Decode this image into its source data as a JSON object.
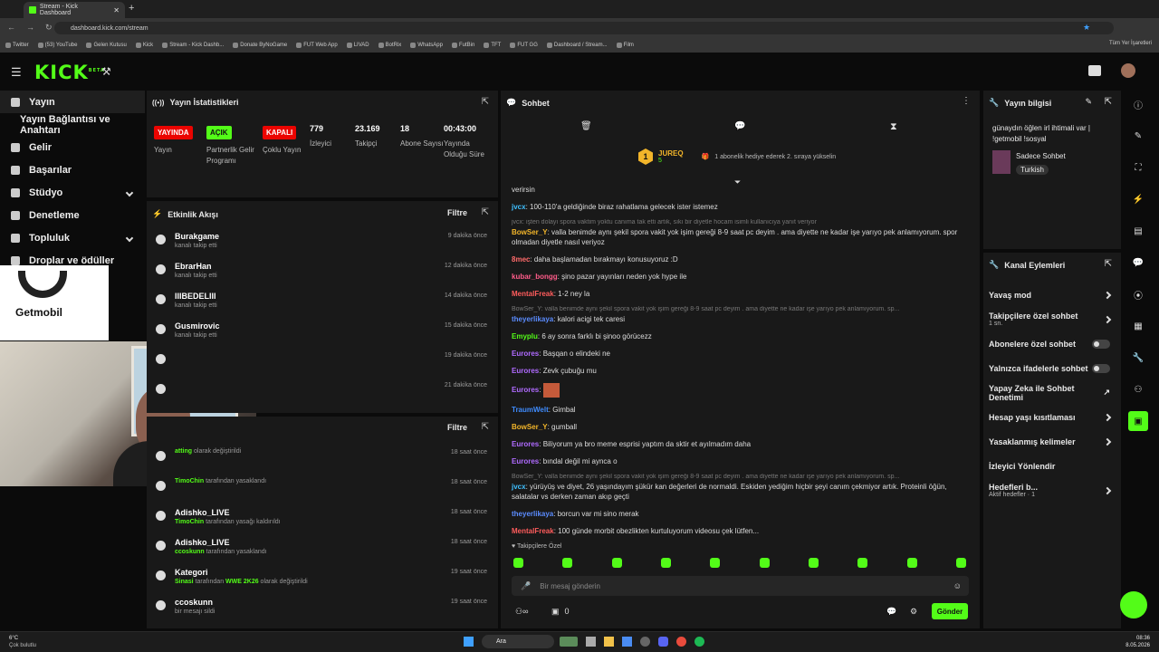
{
  "browser": {
    "tab_title": "Stream - Kick Dashboard",
    "url": "dashboard.kick.com/stream",
    "bookmarks": [
      "Twitter",
      "(53) YouTube",
      "Gelen Kutusu",
      "Kick",
      "Stream - Kick Dashb...",
      "Donate ByNoGame",
      "FUT Web App",
      "LIVAD",
      "BotRix",
      "WhatsApp",
      "FutBin",
      "TFT",
      "FUT GG",
      "Dashboard / Stream...",
      "Film"
    ],
    "all_bookmarks": "Tüm Yer İşaretleri"
  },
  "app": {
    "logo": "KICK",
    "logo_sup": "BETA"
  },
  "sidebar": {
    "items": [
      {
        "label": "Yayın"
      },
      {
        "label": "Yayın Bağlantısı ve Anahtarı"
      },
      {
        "label": "Gelir"
      },
      {
        "label": "Başarılar"
      },
      {
        "label": "Stüdyo"
      },
      {
        "label": "Denetleme"
      },
      {
        "label": "Topluluk"
      },
      {
        "label": "Droplar ve ödüller"
      }
    ]
  },
  "overlay": {
    "brand": "Getmobil"
  },
  "stats": {
    "title": "Yayın İstatistikleri",
    "badges": [
      {
        "text": "YAYINDA",
        "label": "Yayın",
        "color": "#eb0400"
      },
      {
        "text": "AÇIK",
        "label": "Partnerlik Gelir Programı",
        "color": "#53fc18"
      },
      {
        "text": "KAPALI",
        "label": "Çoklu Yayın",
        "color": "#eb0400"
      }
    ],
    "values": [
      {
        "value": "779",
        "label": "İzleyici"
      },
      {
        "value": "23.169",
        "label": "Takipçi"
      },
      {
        "value": "18",
        "label": "Abone Sayısı"
      },
      {
        "value": "00:43:00",
        "label": "Yayında Olduğu Süre"
      }
    ]
  },
  "activity": {
    "title": "Etkinlik Akışı",
    "filter": "Filtre",
    "items": [
      {
        "name": "Burakgame",
        "sub": "kanalı takip etti",
        "time": "9 dakika önce"
      },
      {
        "name": "EbrarHan",
        "sub": "kanalı takip etti",
        "time": "12 dakika önce"
      },
      {
        "name": "IIIBEDELIII",
        "sub": "kanalı takip etti",
        "time": "14 dakika önce"
      },
      {
        "name": "Gusmirovic",
        "sub": "kanalı takip etti",
        "time": "15 dakika önce"
      },
      {
        "name": "",
        "sub": "",
        "time": "19 dakika önce"
      },
      {
        "name": "",
        "sub": "",
        "time": "21 dakika önce"
      }
    ]
  },
  "modlog": {
    "filter": "Filtre",
    "items": [
      {
        "name": "",
        "pre": "atting",
        "post": " olarak değiştirildi",
        "time": "18 saat önce"
      },
      {
        "name": "",
        "pre": "TimoChin",
        "post": " tarafından yasaklandı",
        "time": "18 saat önce"
      },
      {
        "name": "Adishko_LIVE",
        "pre": "TimoChin",
        "post": " tarafından yasağı kaldırıldı",
        "time": "18 saat önce"
      },
      {
        "name": "Adishko_LIVE",
        "pre": "ccoskunn",
        "post": " tarafından yasaklandı",
        "time": "18 saat önce"
      },
      {
        "name": "Kategori",
        "pre": "Sinasi",
        "post": " tarafından ",
        "mid": "WWE 2K26",
        "post2": " olarak değiştirildi",
        "time": "19 saat önce"
      },
      {
        "name": "ccoskunn",
        "pre": "",
        "post": "bir mesajı sildi",
        "time": "19 saat önce"
      }
    ]
  },
  "chat": {
    "title": "Sohbet",
    "pinned": {
      "user": "JUREQ",
      "count": "5",
      "text": "1 abonelik hediye ederek 2. sıraya yükselin"
    },
    "messages": [
      {
        "user": "",
        "color": "#ddd",
        "text": "verirsin"
      },
      {
        "user": "jvcx",
        "color": "#3fc0ff",
        "text": "100-110'a geldiğinde biraz rahatlama gelecek ister istemez"
      },
      {
        "reply": "jvcx: işten dolayı spora vaktim yoktu canıma tak etti artık, sıkı bir diyetle hocam isimli kullanıcıya yanıt veriyor"
      },
      {
        "user": "BowSer_Y",
        "color": "#f2b52a",
        "text": "valla benimde aynı şekil spora vakit yok işim gereği 8-9 saat pc deyim . ama diyette ne kadar işe yarıyo pek anlamıyorum. spor olmadan diyetle nasıl veriyoz"
      },
      {
        "user": "8mec",
        "color": "#ff6b6b",
        "text": "daha başlamadan bırakmayı konusuyoruz :D"
      },
      {
        "user": "kubar_bongg",
        "color": "#ff5c8a",
        "text": "şino pazar yayınları neden yok hype ile"
      },
      {
        "user": "MentalFreak",
        "color": "#ff5c5c",
        "text": "1-2 ney la"
      },
      {
        "reply": "BowSer_Y: valla benimde aynı şekil spora vakit yok işim gereği 8-9 saat pc deyim . ama diyette ne kadar işe yarıyo pek anlamıyorum. sp..."
      },
      {
        "user": "theyerlikaya",
        "color": "#5b8cff",
        "text": "kalori acigi tek caresi"
      },
      {
        "user": "Emyplu",
        "color": "#53fc18",
        "text": "6 ay sonra farklı bi şinoo görücezz"
      },
      {
        "user": "Eurores",
        "color": "#b06bff",
        "text": "Başqan o elindeki ne"
      },
      {
        "user": "Eurores",
        "color": "#b06bff",
        "text": "Zevk çubuğu mu"
      },
      {
        "user": "Eurores",
        "color": "#b06bff",
        "text": "",
        "emote": true
      },
      {
        "user": "TraumWelt",
        "color": "#3f8cff",
        "text": "Gimbal"
      },
      {
        "user": "BowSer_Y",
        "color": "#f2b52a",
        "text": "gumball"
      },
      {
        "user": "Eurores",
        "color": "#b06bff",
        "text": "Biliyorum ya bro meme esprisi yaptım da sktir et ayılmadım daha"
      },
      {
        "user": "Eurores",
        "color": "#b06bff",
        "text": "bındal değil mi aynca o"
      },
      {
        "reply": "BowSer_Y: valla benimde aynı şekil spora vakit yok işim gereği 8-9 saat pc deyim . ama diyette ne kadar işe yarıyo pek anlamıyorum. sp..."
      },
      {
        "user": "jvcx",
        "color": "#3fc0ff",
        "text": "yürüyüş ve diyet, 26 yaşındayım şükür kan değerleri de normaldi. Eskiden yediğim hiçbir şeyi canım çekmiyor artık. Proteinli öğün, salatalar vs derken zaman akıp geçti"
      },
      {
        "user": "theyerlikaya",
        "color": "#5b8cff",
        "text": "borcun var mi sino merak"
      },
      {
        "user": "MentalFreak",
        "color": "#ff5c5c",
        "text": "100 günde morbit obezlikten kurtuluyorum videosu çek lütfen..."
      }
    ],
    "followers_only": "Takipçilere Özel",
    "input_placeholder": "Bir mesaj gönderin",
    "points": "0",
    "send": "Gönder"
  },
  "stream_info": {
    "title": "Yayın bilgisi",
    "text": "günaydın öğlen irl ihtimali var | !getmobil !sosyal",
    "category": "Sadece Sohbet",
    "tag": "Turkish"
  },
  "channel_actions": {
    "title": "Kanal Eylemleri",
    "items": [
      {
        "label": "Yavaş mod",
        "type": "chev"
      },
      {
        "label": "Takipçilere özel sohbet",
        "sub": "1 sn.",
        "type": "chev"
      },
      {
        "label": "Abonelere özel sohbet",
        "type": "toggle"
      },
      {
        "label": "Yalnızca ifadelerle sohbet",
        "type": "toggle"
      },
      {
        "label": "Yapay Zeka ile Sohbet Denetimi",
        "type": "ext"
      },
      {
        "label": "Hesap yaşı kısıtlaması",
        "type": "chev"
      },
      {
        "label": "Yasaklanmış kelimeler",
        "type": "chev"
      },
      {
        "label": "İzleyici Yönlendir",
        "type": "none"
      },
      {
        "label": "Hedefleri b...",
        "sub": "Aktif hedefler · 1",
        "type": "chev"
      }
    ]
  },
  "taskbar": {
    "weather_temp": "6°C",
    "weather_desc": "Çok bulutlu",
    "search": "Ara",
    "time": "08:36",
    "date": "8.05.2026"
  },
  "colors": {
    "accent": "#53fc18",
    "live": "#eb0400",
    "panel": "#191919"
  }
}
